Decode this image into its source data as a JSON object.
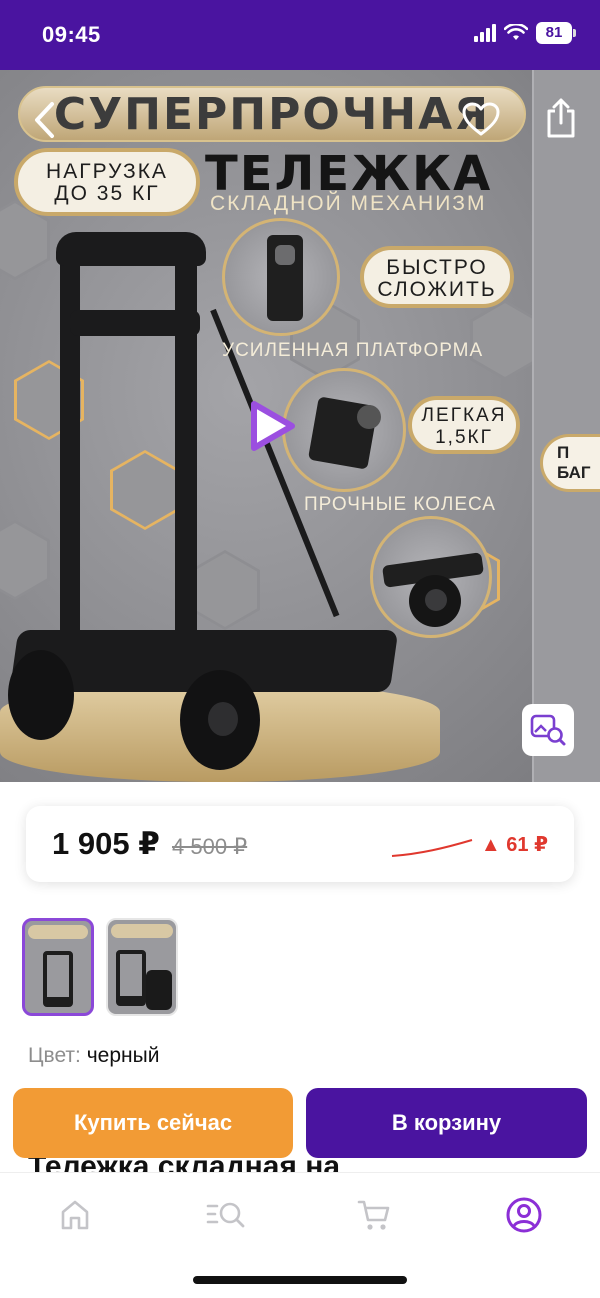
{
  "status_bar": {
    "time": "09:45",
    "battery": "81",
    "icons": [
      "signal-icon",
      "wifi-icon",
      "battery-icon"
    ]
  },
  "hero": {
    "banner_title": "СУПЕРПРОЧНАЯ",
    "banner_subtitle": "ТЕЛЕЖКА",
    "banner_mechanism": "СКЛАДНОЙ МЕХАНИЗМ",
    "load_line1": "НАГРУЗКА",
    "load_line2": "ДО 35 КГ",
    "fold_line1": "БЫСТРО",
    "fold_line2": "СЛОЖИТЬ",
    "platform_label": "УСИЛЕННАЯ ПЛАТФОРМА",
    "weight_line1": "ЛЕГКАЯ",
    "weight_line2": "1,5КГ",
    "wheels_label": "ПРОЧНЫЕ КОЛЕСА",
    "side_card_1": "П",
    "side_card_2": "БАГ"
  },
  "price": {
    "current": "1 905 ₽",
    "old": "4 500 ₽",
    "change": "▲ 61 ₽",
    "change_color": "#e0382e"
  },
  "product": {
    "color_label": "Цвет:",
    "color_value": "черный",
    "title": "Тележка складная на"
  },
  "actions": {
    "buy_now": "Купить сейчас",
    "add_to_cart": "В корзину"
  },
  "thumbnails": [
    {
      "label": "СУПЕРПРОЧНАЯ ТЕЛЕЖКА",
      "selected": true
    },
    {
      "label": "СУПЕРПРОЧНАЯ ТЕЛЕЖКА-СУМКА",
      "selected": false
    }
  ],
  "tabbar": {
    "items": [
      "home-icon",
      "catalog-search-icon",
      "cart-icon",
      "profile-icon"
    ],
    "active": "profile-icon"
  },
  "colors": {
    "brand": "#4a14a0",
    "accent_orange": "#f29b35",
    "selected_border": "#8b48d8"
  }
}
